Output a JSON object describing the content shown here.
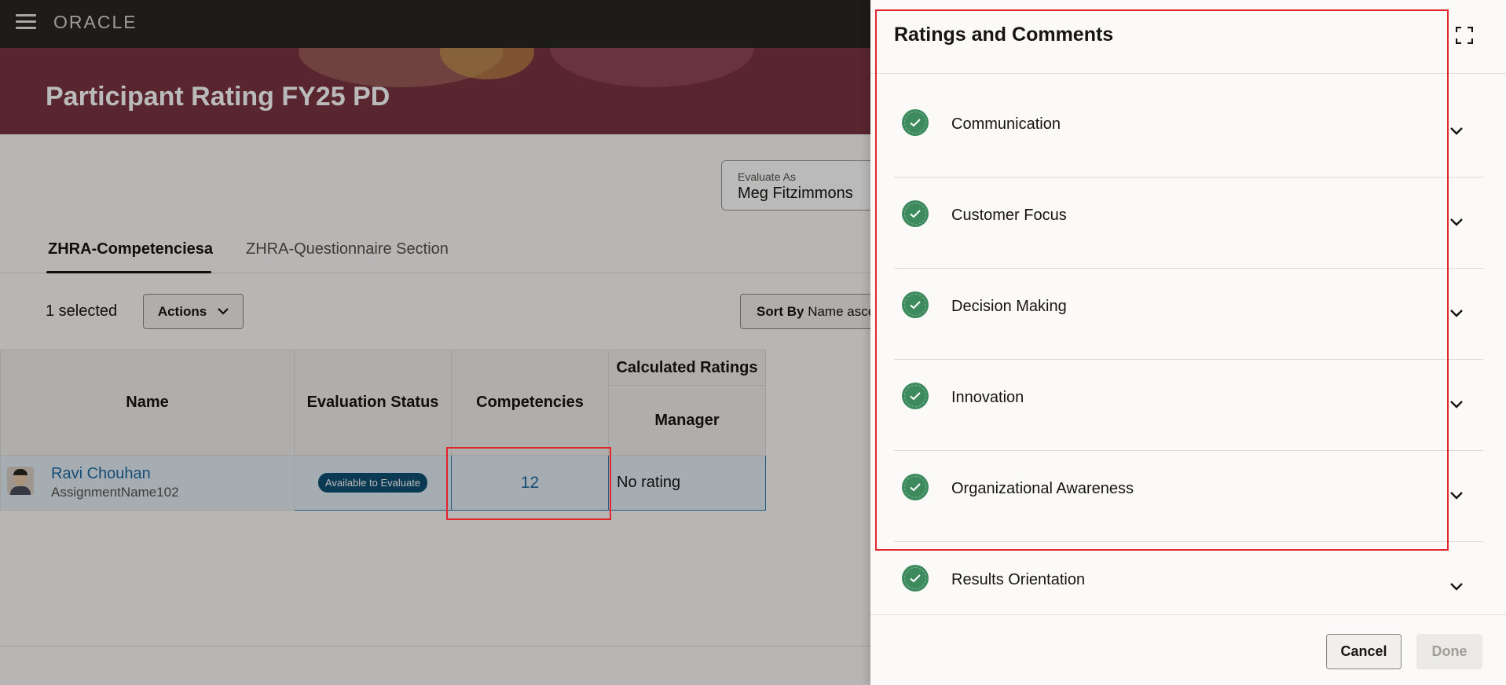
{
  "app": {
    "logo": "ORACLE",
    "page_title": "Participant Rating FY25 PD"
  },
  "evaluate_as": {
    "label": "Evaluate As",
    "value": "Meg Fitzimmons"
  },
  "tabs": [
    {
      "label": "ZHRA-Competenciesa",
      "active": true
    },
    {
      "label": "ZHRA-Questionnaire Section",
      "active": false
    }
  ],
  "toolbar": {
    "selected_count": "1 selected",
    "actions_label": "Actions",
    "sort_label": "Sort By",
    "sort_value": "Name asce"
  },
  "table": {
    "headers": {
      "name": "Name",
      "evaluation_status": "Evaluation Status",
      "competencies": "Competencies",
      "calculated_ratings": "Calculated Ratings",
      "manager": "Manager"
    },
    "rows": [
      {
        "name": "Ravi Chouhan",
        "assignment": "AssignmentName102",
        "status": "Available to Evaluate",
        "competencies": "12",
        "manager_rating": "No rating"
      }
    ]
  },
  "drawer": {
    "title": "Ratings and Comments",
    "items": [
      {
        "label": "Communication",
        "status": "complete"
      },
      {
        "label": "Customer Focus",
        "status": "complete"
      },
      {
        "label": "Decision Making",
        "status": "complete"
      },
      {
        "label": "Innovation",
        "status": "complete"
      },
      {
        "label": "Organizational Awareness",
        "status": "complete"
      },
      {
        "label": "Results Orientation",
        "status": "complete"
      }
    ],
    "cancel_label": "Cancel",
    "done_label": "Done"
  },
  "colors": {
    "banner": "#7a3440",
    "topbar": "#2a2725",
    "check": "#3c8a5e",
    "link": "#1f6aa0",
    "badge": "#0f4f74",
    "highlight": "#e0262c"
  }
}
